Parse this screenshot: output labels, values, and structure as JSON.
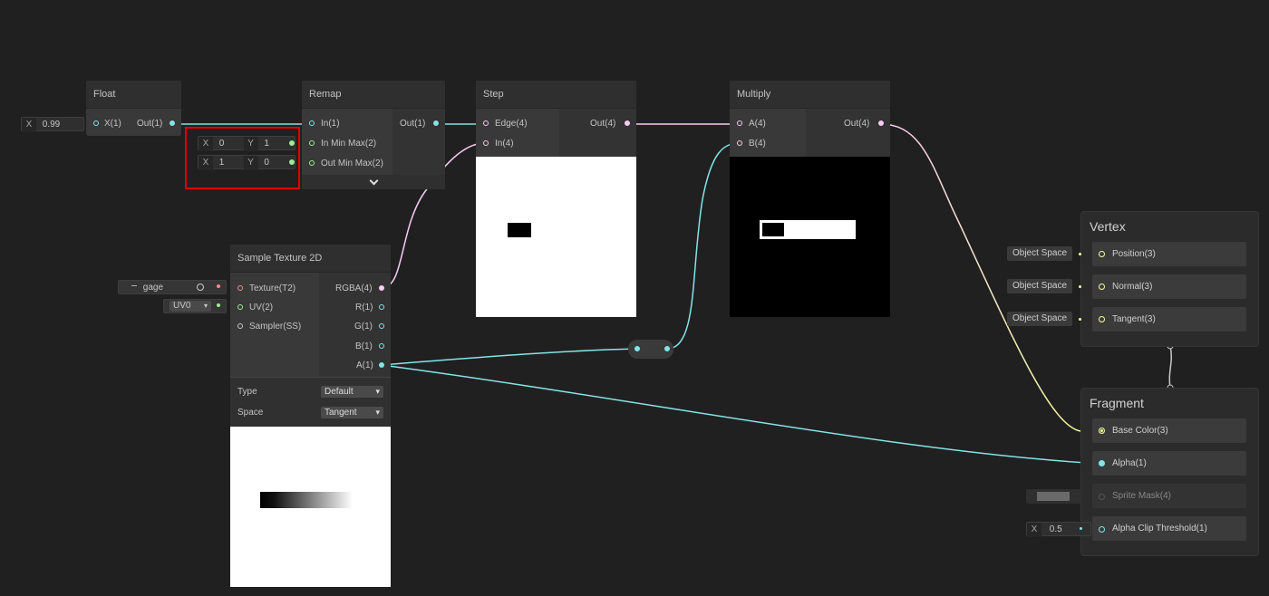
{
  "nodes": {
    "float": {
      "title": "Float",
      "in_port": "X(1)",
      "out_port": "Out(1)",
      "input_label": "X",
      "input_value": "0.99"
    },
    "remap": {
      "title": "Remap",
      "ports_in": [
        "In(1)",
        "In Min Max(2)",
        "Out Min Max(2)"
      ],
      "out_port": "Out(1)",
      "in_min_max": {
        "x_label": "X",
        "x": "0",
        "y_label": "Y",
        "y": "1"
      },
      "out_min_max": {
        "x_label": "X",
        "x": "1",
        "y_label": "Y",
        "y": "0"
      },
      "expand_icon": "chevron-down-icon"
    },
    "step": {
      "title": "Step",
      "ports_in": [
        "Edge(4)",
        "In(4)"
      ],
      "out_port": "Out(4)"
    },
    "multiply": {
      "title": "Multiply",
      "ports_in": [
        "A(4)",
        "B(4)"
      ],
      "out_port": "Out(4)"
    },
    "sample_texture": {
      "title": "Sample Texture 2D",
      "ports_in": [
        "Texture(T2)",
        "UV(2)",
        "Sampler(SS)"
      ],
      "ports_out": [
        "RGBA(4)",
        "R(1)",
        "G(1)",
        "B(1)",
        "A(1)"
      ],
      "texture_field": "gage",
      "uv_field": "UV0",
      "type_label": "Type",
      "type_value": "Default",
      "space_label": "Space",
      "space_value": "Tangent"
    }
  },
  "vertex": {
    "title": "Vertex",
    "slots": [
      "Position(3)",
      "Normal(3)",
      "Tangent(3)"
    ],
    "space_fields": [
      "Object Space",
      "Object Space",
      "Object Space"
    ]
  },
  "fragment": {
    "title": "Fragment",
    "slots": [
      "Base Color(3)",
      "Alpha(1)",
      "Sprite Mask(4)",
      "Alpha Clip Threshold(1)"
    ],
    "alpha_clip_label": "X",
    "alpha_clip_value": "0.5"
  },
  "colors": {
    "background": "#202020",
    "float_wire": "#84e4e7",
    "vector4_wire": "#fbcbf4",
    "vector3_wire": "#f6ff9a",
    "vector2_wire": "#9aef92",
    "texture_wire": "#ff8b8b",
    "highlight": "#e00000"
  }
}
